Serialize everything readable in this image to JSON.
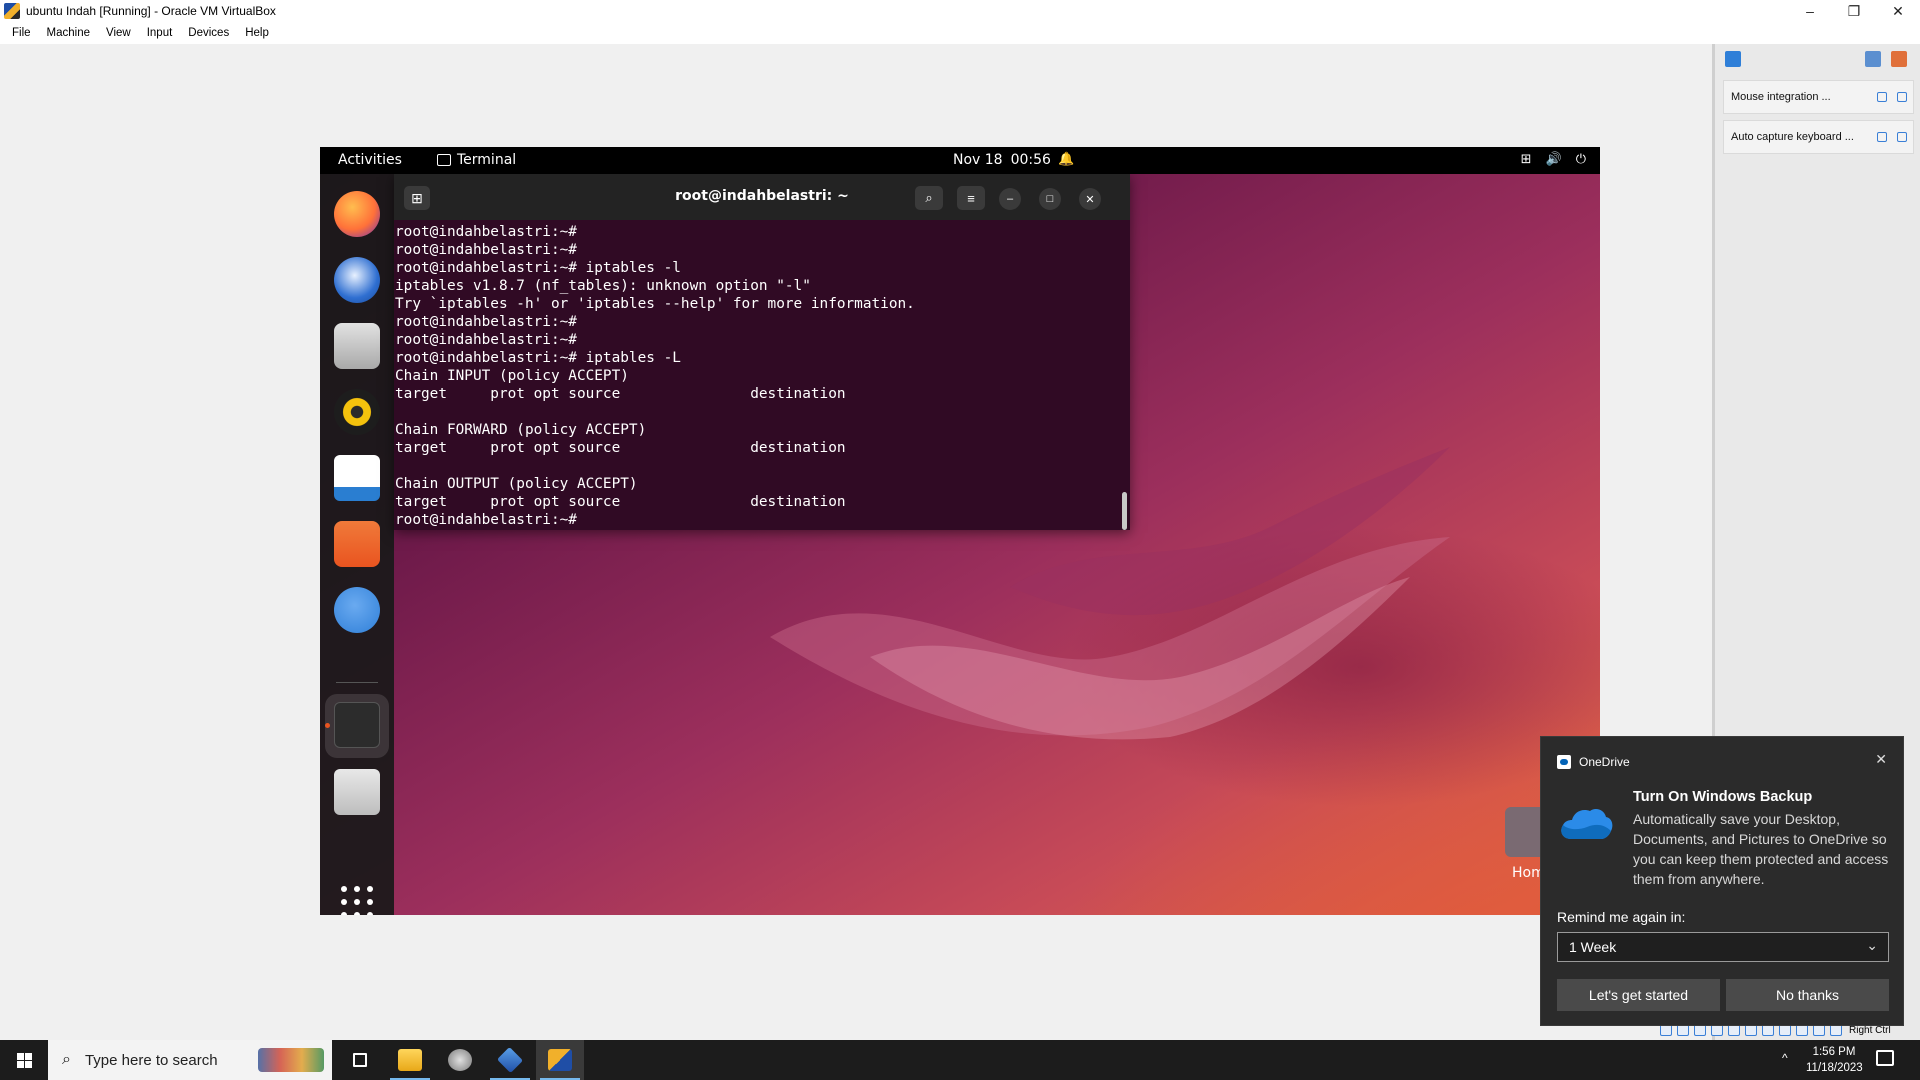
{
  "window": {
    "title": "ubuntu Indah [Running] - Oracle VM VirtualBox",
    "controls": {
      "minimize": "–",
      "restore": "❐",
      "close": "✕"
    }
  },
  "menubar": [
    "File",
    "Machine",
    "View",
    "Input",
    "Devices",
    "Help"
  ],
  "side_panel": {
    "items": [
      {
        "label": "Mouse integration ..."
      },
      {
        "label": "Auto capture keyboard ..."
      }
    ]
  },
  "status_bar": {
    "host_key": "Right Ctrl"
  },
  "guest": {
    "topbar": {
      "activities": "Activities",
      "app_name": "Terminal",
      "date": "Nov 18",
      "time": "00:56",
      "bell_glyph": "🔔",
      "tray": {
        "network": "⊞",
        "volume": "🔊",
        "power": "⏻"
      }
    },
    "dock": {
      "apps": [
        {
          "name": "Firefox",
          "color": "#ff7139"
        },
        {
          "name": "Thunderbird",
          "color": "#2f6fd1"
        },
        {
          "name": "Files",
          "color": "#c9c9c9"
        },
        {
          "name": "Rhythmbox",
          "color": "#f4c20d"
        },
        {
          "name": "LibreOffice Writer",
          "color": "#2a7ed1"
        },
        {
          "name": "Ubuntu Software",
          "color": "#e95420"
        },
        {
          "name": "Help",
          "color": "#3c8ce7"
        },
        {
          "name": "Terminal",
          "color": "#2c2c2c"
        },
        {
          "name": "Trash",
          "color": "#d8d8d8"
        }
      ]
    },
    "terminal": {
      "title": "root@indahbelastri: ~",
      "new_tab_glyph": "⊞",
      "search_glyph": "⌕",
      "menu_glyph": "≡",
      "min_glyph": "–",
      "max_glyph": "□",
      "close_glyph": "✕",
      "lines": [
        "root@indahbelastri:~#",
        "root@indahbelastri:~#",
        "root@indahbelastri:~# iptables -l",
        "iptables v1.8.7 (nf_tables): unknown option \"-l\"",
        "Try `iptables -h' or 'iptables --help' for more information.",
        "root@indahbelastri:~#",
        "root@indahbelastri:~#",
        "root@indahbelastri:~# iptables -L",
        "Chain INPUT (policy ACCEPT)",
        "target     prot opt source               destination",
        "",
        "Chain FORWARD (policy ACCEPT)",
        "target     prot opt source               destination",
        "",
        "Chain OUTPUT (policy ACCEPT)",
        "target     prot opt source               destination",
        "root@indahbelastri:~#"
      ]
    },
    "desktop": {
      "home_label": "Hom"
    }
  },
  "toast": {
    "app": "OneDrive",
    "close_glyph": "✕",
    "title": "Turn On Windows Backup",
    "message": "Automatically save your Desktop, Documents, and Pictures to OneDrive so you can keep them protected and access them from anywhere.",
    "remind_label": "Remind me again in:",
    "remind_value": "1 Week",
    "chevron": "⌄",
    "primary_button": "Let's get started",
    "secondary_button": "No thanks"
  },
  "taskbar": {
    "search_placeholder": "Type here to search",
    "search_glyph": "⌕",
    "tray_chevron": "^",
    "time": "1:56 PM",
    "date": "11/18/2023"
  }
}
